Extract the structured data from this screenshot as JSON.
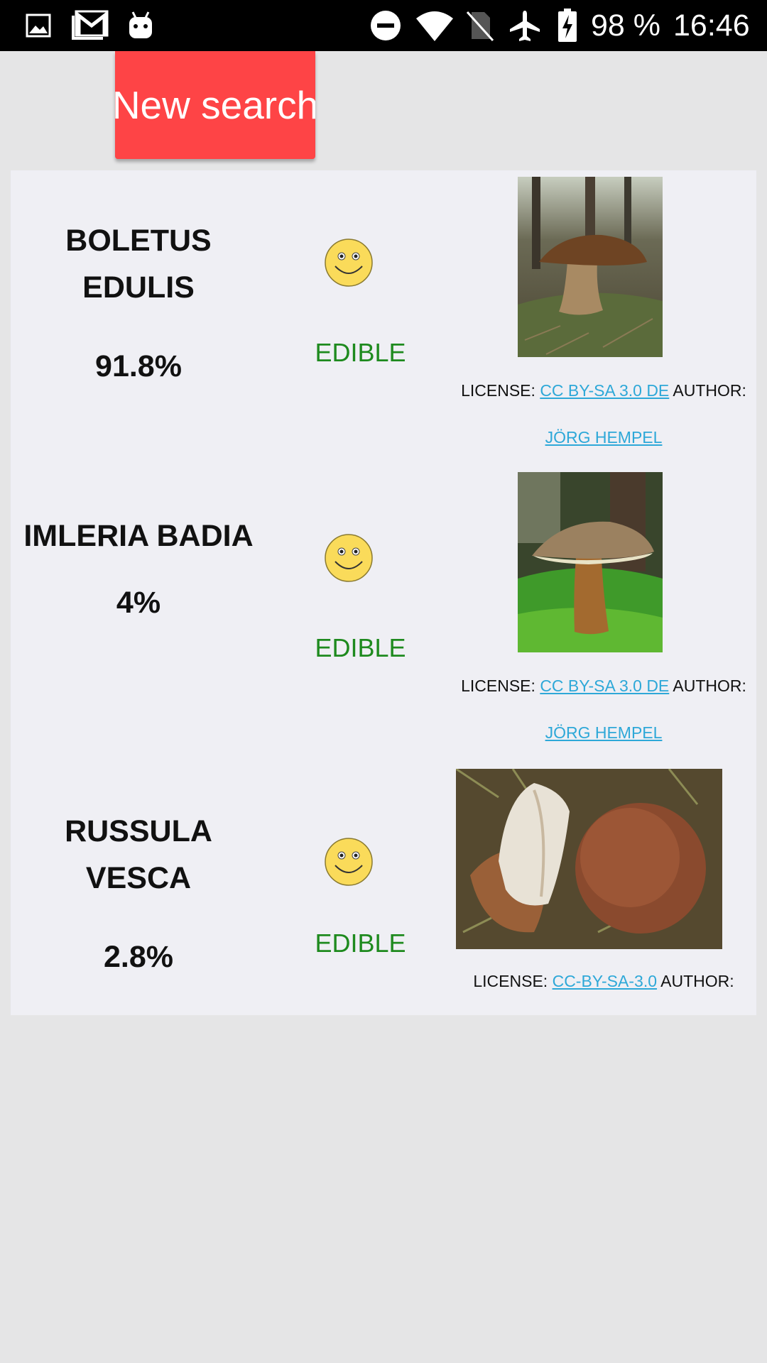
{
  "status_bar": {
    "battery": "98 %",
    "time": "16:46",
    "icons": [
      "image-icon",
      "gmail-icon",
      "android-icon",
      "do-not-disturb-icon",
      "wifi-icon",
      "no-sim-icon",
      "airplane-mode-icon",
      "battery-charging-icon"
    ]
  },
  "toolbar": {
    "new_search_label": "New search"
  },
  "colors": {
    "button": "#fe4446",
    "edible": "#1e8a1e",
    "link": "#2ea8d8",
    "panel": "#efeff4",
    "background": "#e5e5e6"
  },
  "results": [
    {
      "name_line1": "BOLETUS",
      "name_line2": "EDULIS",
      "probability": "91.8%",
      "edibility_icon": "smiley-icon",
      "edibility": "EDIBLE",
      "license_prefix": "LICENSE: ",
      "license_link": "CC BY-SA 3.0 DE",
      "author_prefix": " AUTHOR:",
      "author_link": "JÖRG HEMPEL"
    },
    {
      "name_line1": "IMLERIA BADIA",
      "probability": "4%",
      "edibility_icon": "smiley-icon",
      "edibility": "EDIBLE",
      "license_prefix": "LICENSE: ",
      "license_link": "CC BY-SA 3.0 DE",
      "author_prefix": " AUTHOR:",
      "author_link": "JÖRG HEMPEL"
    },
    {
      "name_line1": "RUSSULA",
      "name_line2": "VESCA",
      "probability": "2.8%",
      "edibility_icon": "smiley-icon",
      "edibility": "EDIBLE",
      "license_prefix": "LICENSE: ",
      "license_link": "CC-BY-SA-3.0",
      "author_prefix": " AUTHOR:"
    }
  ]
}
